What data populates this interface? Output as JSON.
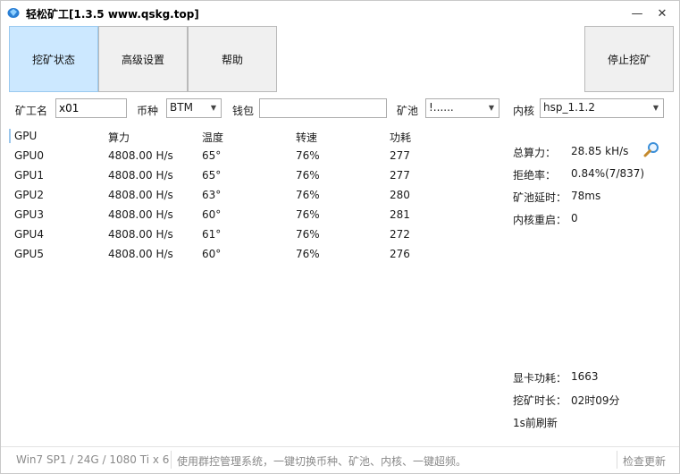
{
  "window": {
    "title": "轻松矿工[1.3.5 www.qskg.top]",
    "min_glyph": "—",
    "close_glyph": "✕"
  },
  "buttons": {
    "status": "挖矿状态",
    "advanced": "高级设置",
    "help": "帮助",
    "stop": "停止挖矿"
  },
  "config": {
    "worker_label": "矿工名",
    "worker_value": "x01",
    "coin_label": "币种",
    "coin_value": "BTM",
    "wallet_label": "钱包",
    "wallet_value": "",
    "pool_label": "矿池",
    "pool_value": "!......",
    "kernel_label": "内核",
    "kernel_value": "hsp_1.1.2"
  },
  "gpu_table": {
    "headers": [
      "GPU",
      "算力",
      "温度",
      "转速",
      "功耗"
    ],
    "rows": [
      [
        "GPU0",
        "4808.00 H/s",
        "65°",
        "76%",
        "277"
      ],
      [
        "GPU1",
        "4808.00 H/s",
        "65°",
        "76%",
        "277"
      ],
      [
        "GPU2",
        "4808.00 H/s",
        "63°",
        "76%",
        "280"
      ],
      [
        "GPU3",
        "4808.00 H/s",
        "60°",
        "76%",
        "281"
      ],
      [
        "GPU4",
        "4808.00 H/s",
        "61°",
        "76%",
        "272"
      ],
      [
        "GPU5",
        "4808.00 H/s",
        "60°",
        "76%",
        "276"
      ]
    ]
  },
  "stats": {
    "total_hash_label": "总算力：",
    "total_hash_value": "28.85 kH/s",
    "reject_label": "拒绝率：",
    "reject_value": "0.84%(7/837)",
    "pool_latency_label": "矿池延时：",
    "pool_latency_value": "78ms",
    "kernel_restart_label": "内核重启：",
    "kernel_restart_value": "0",
    "gpu_power_label": "显卡功耗：",
    "gpu_power_value": "1663",
    "mining_time_label": "挖矿时长：",
    "mining_time_value": "02时09分",
    "refresh_text": "1s前刷新"
  },
  "statusbar": {
    "system_info": "Win7 SP1 / 24G / 1080 Ti x 6",
    "promo": "使用群控管理系统，一键切换币种、矿池、内核、一键超频。",
    "check_update": "检查更新"
  },
  "colors": {
    "active_tab": "#cce8ff",
    "accent": "#3b8fd9"
  }
}
